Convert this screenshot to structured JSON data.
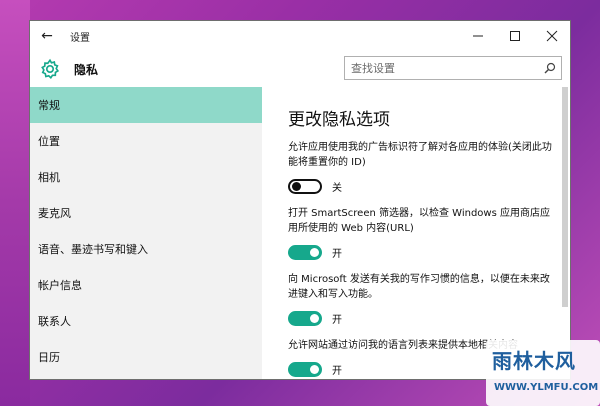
{
  "window": {
    "title": "设置",
    "back": "←",
    "controls": {
      "minimize": "—",
      "maximize": "☐",
      "close": "✕"
    }
  },
  "header": {
    "title": "隐私",
    "search_placeholder": "查找设置"
  },
  "sidebar": {
    "items": [
      {
        "label": "常规",
        "active": true
      },
      {
        "label": "位置"
      },
      {
        "label": "相机"
      },
      {
        "label": "麦克风"
      },
      {
        "label": "语音、墨迹书写和键入"
      },
      {
        "label": "帐户信息"
      },
      {
        "label": "联系人"
      },
      {
        "label": "日历"
      }
    ]
  },
  "content": {
    "title": "更改隐私选项",
    "settings": [
      {
        "desc": "允许应用使用我的广告标识符了解对各应用的体验(关闭此功能将重置你的 ID)",
        "state": "关",
        "on": false
      },
      {
        "desc": "打开 SmartScreen 筛选器，以检查 Windows 应用商店应用所使用的 Web 内容(URL)",
        "state": "开",
        "on": true
      },
      {
        "desc": "向 Microsoft 发送有关我的写作习惯的信息，以便在未来改进键入和写入功能。",
        "state": "开",
        "on": true
      },
      {
        "desc": "允许网站通过访问我的语言列表来提供本地相关内容",
        "state": "开",
        "on": true
      }
    ]
  },
  "watermark": {
    "title": "雨林木风",
    "url": "WWW.YLMFU.COM"
  },
  "colors": {
    "accent": "#16a88c",
    "active_item": "#8fd9c9",
    "sidebar_bg": "#f2f2f2"
  }
}
